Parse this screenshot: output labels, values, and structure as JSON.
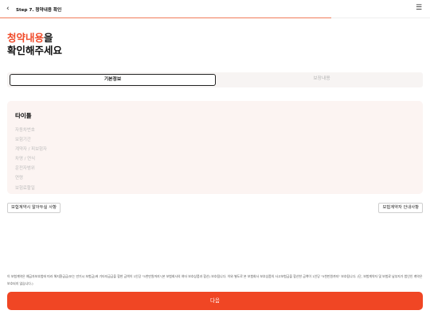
{
  "header": {
    "back_icon": "chevron-left-icon",
    "step_title": "Step 7. 청약내용 확인",
    "menu_icon": "hamburger-menu-icon",
    "progress_fraction": 0.77
  },
  "headline": {
    "accent": "청약내용",
    "suffix": "을",
    "line2": "확인해주세요"
  },
  "tabs": [
    {
      "label": "기본정보",
      "active": true
    },
    {
      "label": "보장내용",
      "active": false
    }
  ],
  "card": {
    "title": "타이틀",
    "rows": [
      "자동차번호",
      "보험기간",
      "계약자 / 피보험자",
      "차명 / 연식",
      "운전자범위",
      "연령",
      "보험료할일"
    ]
  },
  "links": {
    "left": "보험계약시 알아두실 사항",
    "right": "보험계약자 안내사항"
  },
  "notice": "이 보험계약은 예금자보호법에 따라 해지환급금(또는 만기시 보험금)에 기타지급금을 합한 금액이 1인당 \"5천만원까지\"(본 보험회사의 여타 보호상품과 합산) 보호됩니다. 이와 별도로 본 보험회사 보호상품의 사고보험금을 합산한 금액이 1인당 \"5천만원까지\" 보호됩니다. (단, 보험계약자 및 보험료 납부자가 법인인 계약은 보호되지 않습니다.)",
  "next_button": "다음",
  "colors": {
    "accent": "#f04b2a",
    "button": "#f04624",
    "card_bg": "#fcf4f2"
  }
}
